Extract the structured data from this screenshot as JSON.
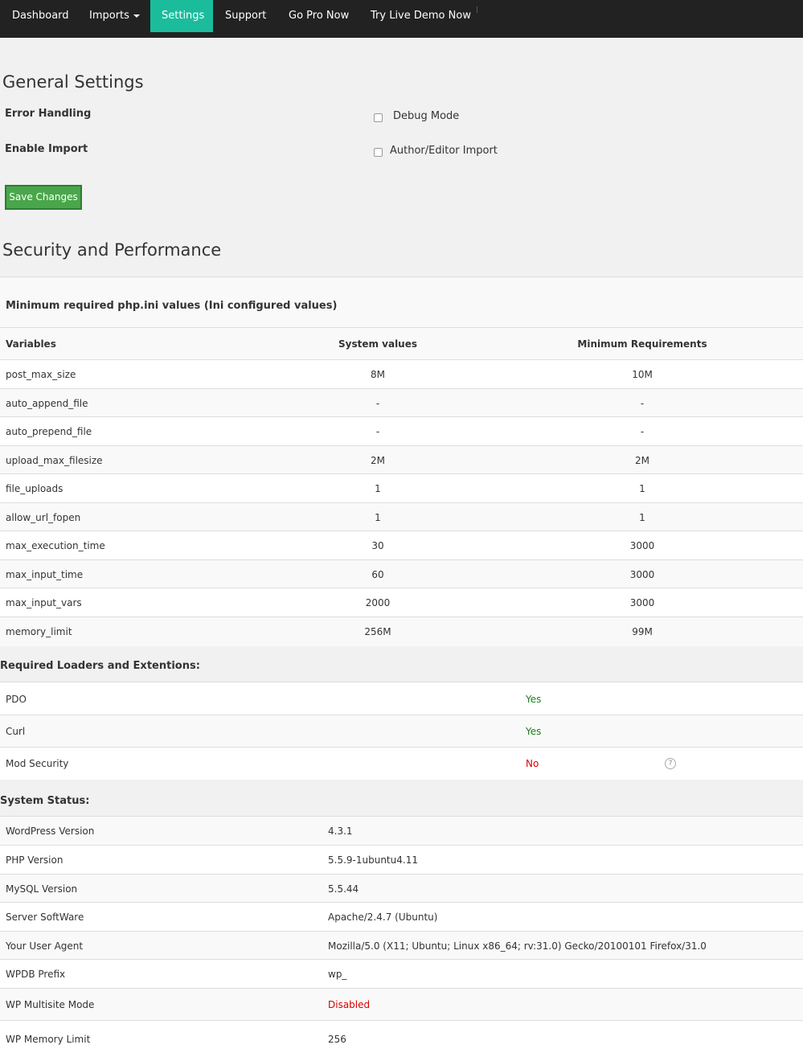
{
  "nav": {
    "items": [
      {
        "label": "Dashboard"
      },
      {
        "label": "Imports"
      },
      {
        "label": "Settings"
      },
      {
        "label": "Support"
      },
      {
        "label": "Go Pro Now"
      },
      {
        "label": "Try Live Demo Now"
      }
    ],
    "active": "Settings"
  },
  "general": {
    "title": "General Settings",
    "error_handling_label": "Error Handling",
    "debug_mode_label": "Debug Mode",
    "debug_mode_checked": false,
    "enable_import_label": "Enable Import",
    "author_import_label": "Author/Editor Import",
    "author_import_checked": false,
    "save_label": "Save Changes"
  },
  "security": {
    "title": "Security and Performance",
    "ini_heading": "Minimum required php.ini values (Ini configured values)",
    "columns": [
      "Variables",
      "System values",
      "Minimum Requirements"
    ],
    "rows": [
      {
        "name": "post_max_size",
        "system": "8M",
        "minimum": "10M"
      },
      {
        "name": "auto_append_file",
        "system": "-",
        "minimum": "-"
      },
      {
        "name": "auto_prepend_file",
        "system": "-",
        "minimum": "-"
      },
      {
        "name": "upload_max_filesize",
        "system": "2M",
        "minimum": "2M"
      },
      {
        "name": "file_uploads",
        "system": "1",
        "minimum": "1"
      },
      {
        "name": "allow_url_fopen",
        "system": "1",
        "minimum": "1"
      },
      {
        "name": "max_execution_time",
        "system": "30",
        "minimum": "3000"
      },
      {
        "name": "max_input_time",
        "system": "60",
        "minimum": "3000"
      },
      {
        "name": "max_input_vars",
        "system": "2000",
        "minimum": "3000"
      },
      {
        "name": "memory_limit",
        "system": "256M",
        "minimum": "99M"
      }
    ]
  },
  "loaders": {
    "title": "Required Loaders and Extentions:",
    "rows": [
      {
        "name": "PDO",
        "status": "Yes"
      },
      {
        "name": "Curl",
        "status": "Yes"
      },
      {
        "name": "Mod Security",
        "status": "No",
        "help": "?"
      }
    ]
  },
  "status": {
    "title": "System Status:",
    "rows": [
      {
        "name": "WordPress Version",
        "value": "4.3.1"
      },
      {
        "name": "PHP Version",
        "value": "5.5.9-1ubuntu4.11"
      },
      {
        "name": "MySQL Version",
        "value": "5.5.44"
      },
      {
        "name": "Server SoftWare",
        "value": "Apache/2.4.7 (Ubuntu)"
      },
      {
        "name": "Your User Agent",
        "value": "Mozilla/5.0 (X11; Ubuntu; Linux x86_64; rv:31.0) Gecko/20100101 Firefox/31.0"
      },
      {
        "name": "WPDB Prefix",
        "value": "wp_"
      },
      {
        "name": "WP Multisite Mode",
        "value": "Disabled"
      },
      {
        "name": "WP Memory Limit",
        "value": "256"
      }
    ]
  },
  "colors": {
    "nav_bg": "#222222",
    "active_tab": "#1abc9c",
    "save_button": "#4aa64a",
    "yes": "#1a7f1a",
    "no": "#dd0000"
  }
}
